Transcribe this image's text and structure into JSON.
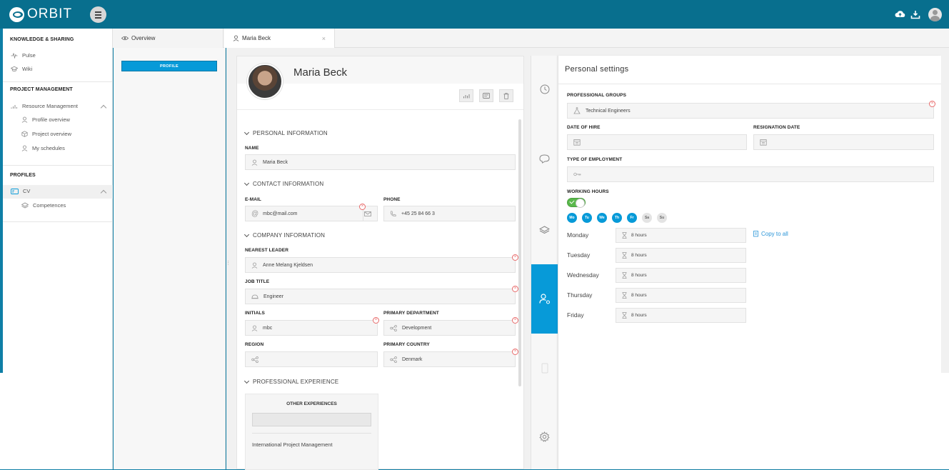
{
  "topbar": {
    "logo_text": "ORBIT",
    "icons": [
      "cloud-upload-icon",
      "download-icon",
      "user-avatar-icon"
    ]
  },
  "tabs": [
    {
      "label": "Overview",
      "icon": "eye-icon"
    },
    {
      "label": "Maria Beck",
      "icon": "user-icon",
      "close": "×"
    }
  ],
  "sidebar": {
    "sections": [
      {
        "title": "KNOWLEDGE & SHARING",
        "items": [
          "Pulse",
          "Wiki"
        ]
      },
      {
        "title": "PROJECT MANAGEMENT",
        "items": [
          "Resource Management",
          "Profile overview",
          "Project overview",
          "My schedules"
        ]
      },
      {
        "title": "PROFILES",
        "items": [
          "CV",
          "Competences"
        ]
      }
    ]
  },
  "left_panel": {
    "profile_button": "PROFILE"
  },
  "profile": {
    "name": "Maria Beck",
    "sections": {
      "personal": "PERSONAL INFORMATION",
      "contact": "CONTACT INFORMATION",
      "company": "COMPANY INFORMATION",
      "experience": "PROFESSIONAL EXPERIENCE"
    },
    "fields": {
      "name_label": "NAME",
      "name_value": "Maria Beck",
      "email_label": "E-MAIL",
      "email_value": "mbc@mail.com",
      "phone_label": "PHONE",
      "phone_value": "+45 25 84 66 3",
      "leader_label": "NEAREST LEADER",
      "leader_value": "Anne Melang Kjeldsen",
      "job_label": "JOB TITLE",
      "job_value": "Engineer",
      "initials_label": "INITIALS",
      "initials_value": "mbc",
      "dept_label": "PRIMARY DEPARTMENT",
      "dept_value": "Development",
      "region_label": "REGION",
      "region_value": "",
      "country_label": "PRIMARY COUNTRY",
      "country_value": "Denmark"
    },
    "other_experiences": {
      "title": "OTHER EXPERIENCES",
      "items": [
        "International Project Management"
      ]
    },
    "required_mark": "×"
  },
  "personal_settings": {
    "title": "Personal settings",
    "professional_groups_label": "PROFESSIONAL GROUPS",
    "professional_groups_value": "Technical Engineers",
    "date_of_hire_label": "DATE OF HIRE",
    "resignation_date_label": "RESIGNATION DATE",
    "type_of_employment_label": "TYPE OF EMPLOYMENT",
    "type_of_employment_value": "",
    "working_hours_label": "WORKING HOURS",
    "working_hours_enabled": true,
    "day_chips": [
      {
        "label": "Mo",
        "on": true
      },
      {
        "label": "Tu",
        "on": true
      },
      {
        "label": "We",
        "on": true
      },
      {
        "label": "Th",
        "on": true
      },
      {
        "label": "Fr",
        "on": true
      },
      {
        "label": "Sa",
        "on": false
      },
      {
        "label": "Su",
        "on": false
      }
    ],
    "days": [
      {
        "name": "Monday",
        "hours": "8 hours"
      },
      {
        "name": "Tuesday",
        "hours": "8 hours"
      },
      {
        "name": "Wednesday",
        "hours": "8 hours"
      },
      {
        "name": "Thursday",
        "hours": "8 hours"
      },
      {
        "name": "Friday",
        "hours": "8 hours"
      }
    ],
    "copy_to_all": "Copy to all"
  },
  "colors": {
    "brand": "#086f8e",
    "accent": "#079ad8",
    "required": "#e86a6a",
    "toggle_on": "#59b84b"
  }
}
